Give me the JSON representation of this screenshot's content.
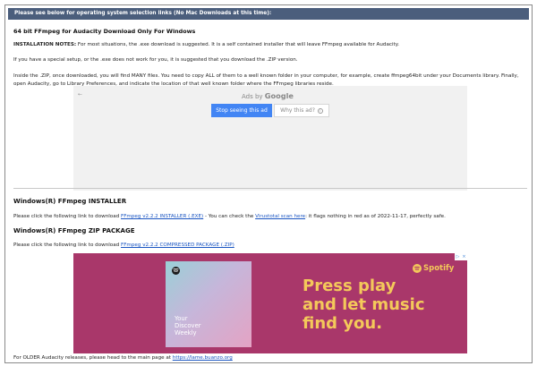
{
  "banner": {
    "text": "Please see below for operating system selection links (No Mac Downloads at this time):"
  },
  "section64": {
    "title": "64 bit FFmpeg for Audacity Download Only For Windows",
    "notes_label": "INSTALLATION NOTES:",
    "notes_text": " For most situations, the .exe download is suggested. It is a self contained installer that will leave FFmpeg available for Audacity.",
    "special": "If you have a special setup, or the .exe does not work for you, it is suggested that you download the .ZIP version.",
    "inside_zip": "Inside the .ZIP, once downloaded, you will find MANY files. You need to copy ALL of them to a well known folder in your computer, for example, create ffmpeg64bit under your Documents library. Finally, open Audacity, go to Library Preferences, and indicate the location of that well known folder where the FFmpeg libraries reside."
  },
  "ad_google": {
    "back_arrow": "←",
    "ads_by": "Ads by ",
    "google": "Google",
    "stop_button": "Stop seeing this ad",
    "why_button": "Why this ad?",
    "why_icon": "i",
    "background_color": "#f1f1f1",
    "button_color": "#4285f4"
  },
  "installer": {
    "heading": "Windows(R) FFmpeg INSTALLER",
    "text_before": "Please click the following link to download ",
    "link": "FFmpeg v2.2.2 INSTALLER (.EXE)",
    "text_mid": " - You can check the ",
    "scan_link": "Virustotal scan here",
    "text_after": ": it flags nothing in red as of 2022-11-17, perfectly safe."
  },
  "zip": {
    "heading": "Windows(R) FFmpeg ZIP PACKAGE",
    "text_before": "Please click the following link to download ",
    "link": "FFmpeg v2.2.2 COMPRESSED PACKAGE (.ZIP)"
  },
  "ad_spotify": {
    "brand": "Spotify",
    "headline": [
      "Press play",
      "and let music",
      "find you."
    ],
    "album_caption": [
      "Your",
      "Discover",
      "Weekly"
    ],
    "background_color": "#a9376a",
    "accent_color": "#f4c95a",
    "adchoices_icon": "▷",
    "close_icon": "×"
  },
  "footer": {
    "text": "For OLDER Audacity releases, please head to the main page at ",
    "link": "https://lame.buanzo.org"
  }
}
